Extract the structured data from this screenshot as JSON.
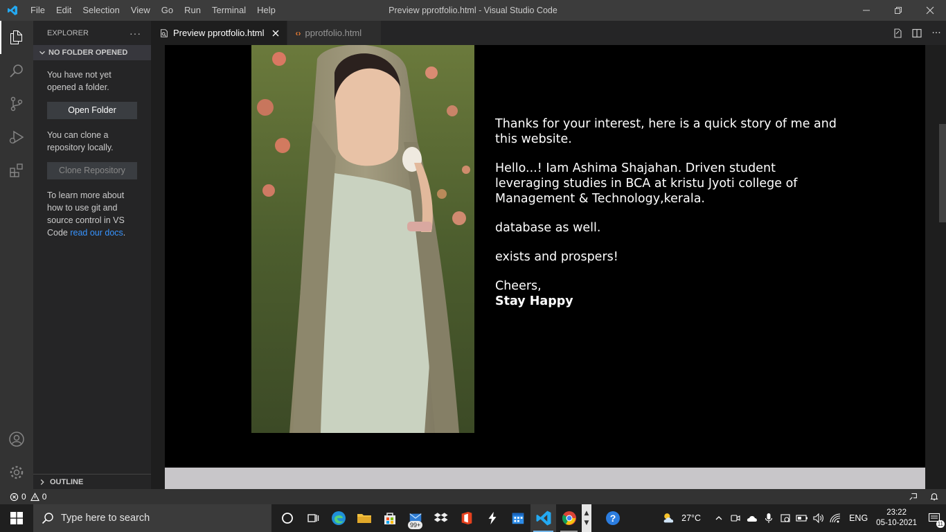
{
  "app": {
    "window_title": "Preview pprotfolio.html - Visual Studio Code",
    "menu": [
      "File",
      "Edit",
      "Selection",
      "View",
      "Go",
      "Run",
      "Terminal",
      "Help"
    ]
  },
  "sidebar": {
    "header": "EXPLORER",
    "section": "NO FOLDER OPENED",
    "text_not_opened": "You have not yet opened a folder.",
    "open_folder": "Open Folder",
    "text_clone": "You can clone a repository locally.",
    "clone_repository": "Clone Repository",
    "text_learn": "To learn more about how to use git and source control in VS Code ",
    "docs_link": "read our docs",
    "text_period": ".",
    "outline": "OUTLINE"
  },
  "tabs": [
    {
      "label": "Preview pprotfolio.html",
      "active": true
    },
    {
      "label": "pprotfolio.html",
      "active": false
    }
  ],
  "preview": {
    "intro": "Thanks for your interest, here is a quick story of me and this website.",
    "hello": "Hello...! Iam Ashima Shajahan. Driven student leveraging studies in BCA at kristu Jyoti college of Management & Technology,kerala.",
    "database": "database as well.",
    "exists": "exists and prospers!",
    "cheers": "Cheers,",
    "stay_happy": "Stay Happy"
  },
  "status": {
    "errors": "0",
    "warnings": "0"
  },
  "taskbar": {
    "search_placeholder": "Type here to search",
    "store_badge": "99+",
    "weather": "27°C",
    "language": "ENG",
    "time": "23:22",
    "date": "05-10-2021",
    "notification_count": "11"
  },
  "colors": {
    "accent": "#007acc",
    "link": "#3794ff",
    "titlebar": "#3c3c3c",
    "activitybar": "#333333",
    "sidebar": "#252526"
  }
}
